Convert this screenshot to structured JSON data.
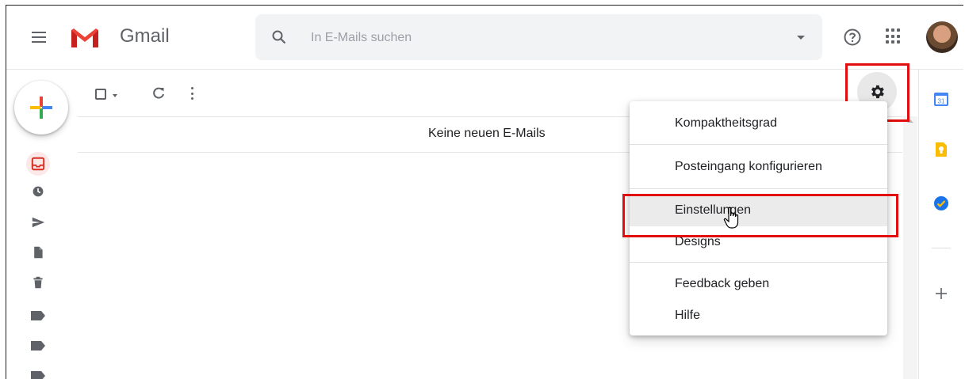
{
  "header": {
    "brand": "Gmail",
    "search_placeholder": "In E-Mails suchen"
  },
  "toolbar": {
    "empty_message": "Keine neuen E-Mails"
  },
  "settings_menu": {
    "items": [
      {
        "label": "Kompaktheitsgrad"
      },
      {
        "label": "Posteingang konfigurieren"
      },
      {
        "label": "Einstellungen",
        "hovered": true
      },
      {
        "label": "Designs"
      },
      {
        "label": "Feedback geben"
      },
      {
        "label": "Hilfe"
      }
    ]
  },
  "side_panel": {
    "calendar_day": "31"
  },
  "colors": {
    "highlight": "#e20d0d",
    "gmail_red": "#ea4335",
    "keep_yellow": "#fbbc04",
    "tasks_blue": "#1a73e8"
  }
}
